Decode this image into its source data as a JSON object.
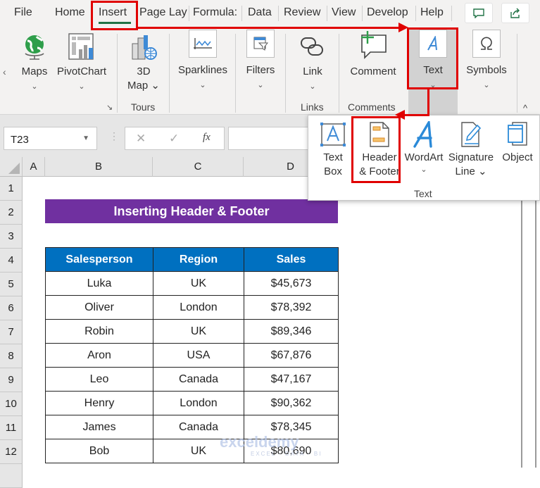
{
  "tabs": [
    {
      "label": "File",
      "active": false
    },
    {
      "label": "Home",
      "active": false
    },
    {
      "label": "Insert",
      "active": true
    },
    {
      "label": "Page Lay",
      "active": false
    },
    {
      "label": "Formula:",
      "active": false
    },
    {
      "label": "Data",
      "active": false
    },
    {
      "label": "Review",
      "active": false
    },
    {
      "label": "View",
      "active": false
    },
    {
      "label": "Develop",
      "active": false
    },
    {
      "label": "Help",
      "active": false
    }
  ],
  "top_buttons": {
    "comments_icon": "comment-icon",
    "share_icon": "share-icon"
  },
  "ribbon": {
    "scroll_left": "‹",
    "maps": {
      "label": "Maps",
      "caret": "⌄"
    },
    "pivotchart": {
      "label": "PivotChart",
      "caret": "⌄"
    },
    "map3d": {
      "label1": "3D",
      "label2": "Map ⌄"
    },
    "sparklines": {
      "label": "Sparklines",
      "caret": "⌄"
    },
    "filters": {
      "label": "Filters",
      "caret": "⌄"
    },
    "link": {
      "label": "Link",
      "caret": "⌄"
    },
    "comment": {
      "label": "Comment"
    },
    "text": {
      "label": "Text",
      "caret": "⌄"
    },
    "symbols": {
      "label": "Symbols",
      "caret": "⌄"
    },
    "groups": {
      "tours": "Tours",
      "links": "Links",
      "comments": "Comments"
    },
    "dialog_launcher": "↘",
    "collapse": "^"
  },
  "formula_bar": {
    "name_box": "T23",
    "cancel": "✕",
    "enter": "✓",
    "fx": "fx",
    "formula": ""
  },
  "columns": [
    "A",
    "B",
    "C",
    "D"
  ],
  "rows": [
    "1",
    "2",
    "3",
    "4",
    "5",
    "6",
    "7",
    "8",
    "9",
    "10",
    "11",
    "12"
  ],
  "sheet": {
    "title": "Inserting Header & Footer",
    "headers": [
      "Salesperson",
      "Region",
      "Sales"
    ],
    "data": [
      [
        "Luka",
        "UK",
        "$45,673"
      ],
      [
        "Oliver",
        "London",
        "$78,392"
      ],
      [
        "Robin",
        "UK",
        "$89,346"
      ],
      [
        "Aron",
        "USA",
        "$67,876"
      ],
      [
        "Leo",
        "Canada",
        "$47,167"
      ],
      [
        "Henry",
        "London",
        "$90,362"
      ],
      [
        "James",
        "Canada",
        "$78,345"
      ],
      [
        "Bob",
        "UK",
        "$80,690"
      ]
    ]
  },
  "text_dropdown": {
    "items": [
      {
        "line1": "Text",
        "line2": "Box"
      },
      {
        "line1": "Header",
        "line2": "& Footer"
      },
      {
        "line1": "WordArt",
        "line2": "⌄"
      },
      {
        "line1": "Signature",
        "line2": "Line ⌄"
      },
      {
        "line1": "Object",
        "line2": ""
      }
    ],
    "group_label": "Text"
  },
  "watermark": {
    "brand": "exceldemy",
    "tagline": "EXCEL · DATA · BI"
  },
  "colors": {
    "accent_green": "#217346",
    "title_purple": "#7030a0",
    "header_blue": "#0070c0",
    "annotation_red": "#e00000"
  }
}
